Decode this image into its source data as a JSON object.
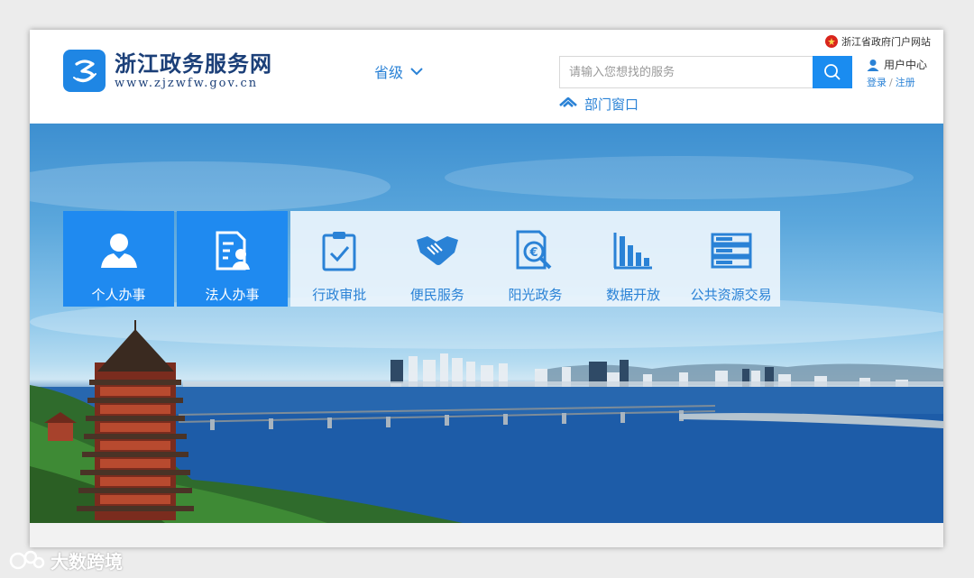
{
  "header": {
    "logo_title": "浙江政务服务网",
    "logo_url": "www.zjzwfw.gov.cn",
    "region_label": "省级",
    "search_placeholder": "请输入您想找的服务",
    "dept_link": "部门窗口",
    "gov_portal_link": "浙江省政府门户网站",
    "user_center": "用户中心",
    "login": "登录",
    "separator": "/",
    "register": "注册"
  },
  "tiles": {
    "primary": [
      {
        "label": "个人办事",
        "icon": "person-icon"
      },
      {
        "label": "法人办事",
        "icon": "legal-person-icon"
      }
    ],
    "secondary": [
      {
        "label": "行政审批",
        "icon": "clipboard-check-icon"
      },
      {
        "label": "便民服务",
        "icon": "handshake-icon"
      },
      {
        "label": "阳光政务",
        "icon": "document-search-icon"
      },
      {
        "label": "数据开放",
        "icon": "bar-chart-icon"
      },
      {
        "label": "公共资源交易",
        "icon": "server-stack-icon"
      }
    ]
  },
  "watermark": {
    "text": "大数跨境"
  },
  "colors": {
    "brand_blue": "#1f8af0",
    "link_blue": "#2a82d6",
    "logo_navy": "#1b3f78"
  }
}
